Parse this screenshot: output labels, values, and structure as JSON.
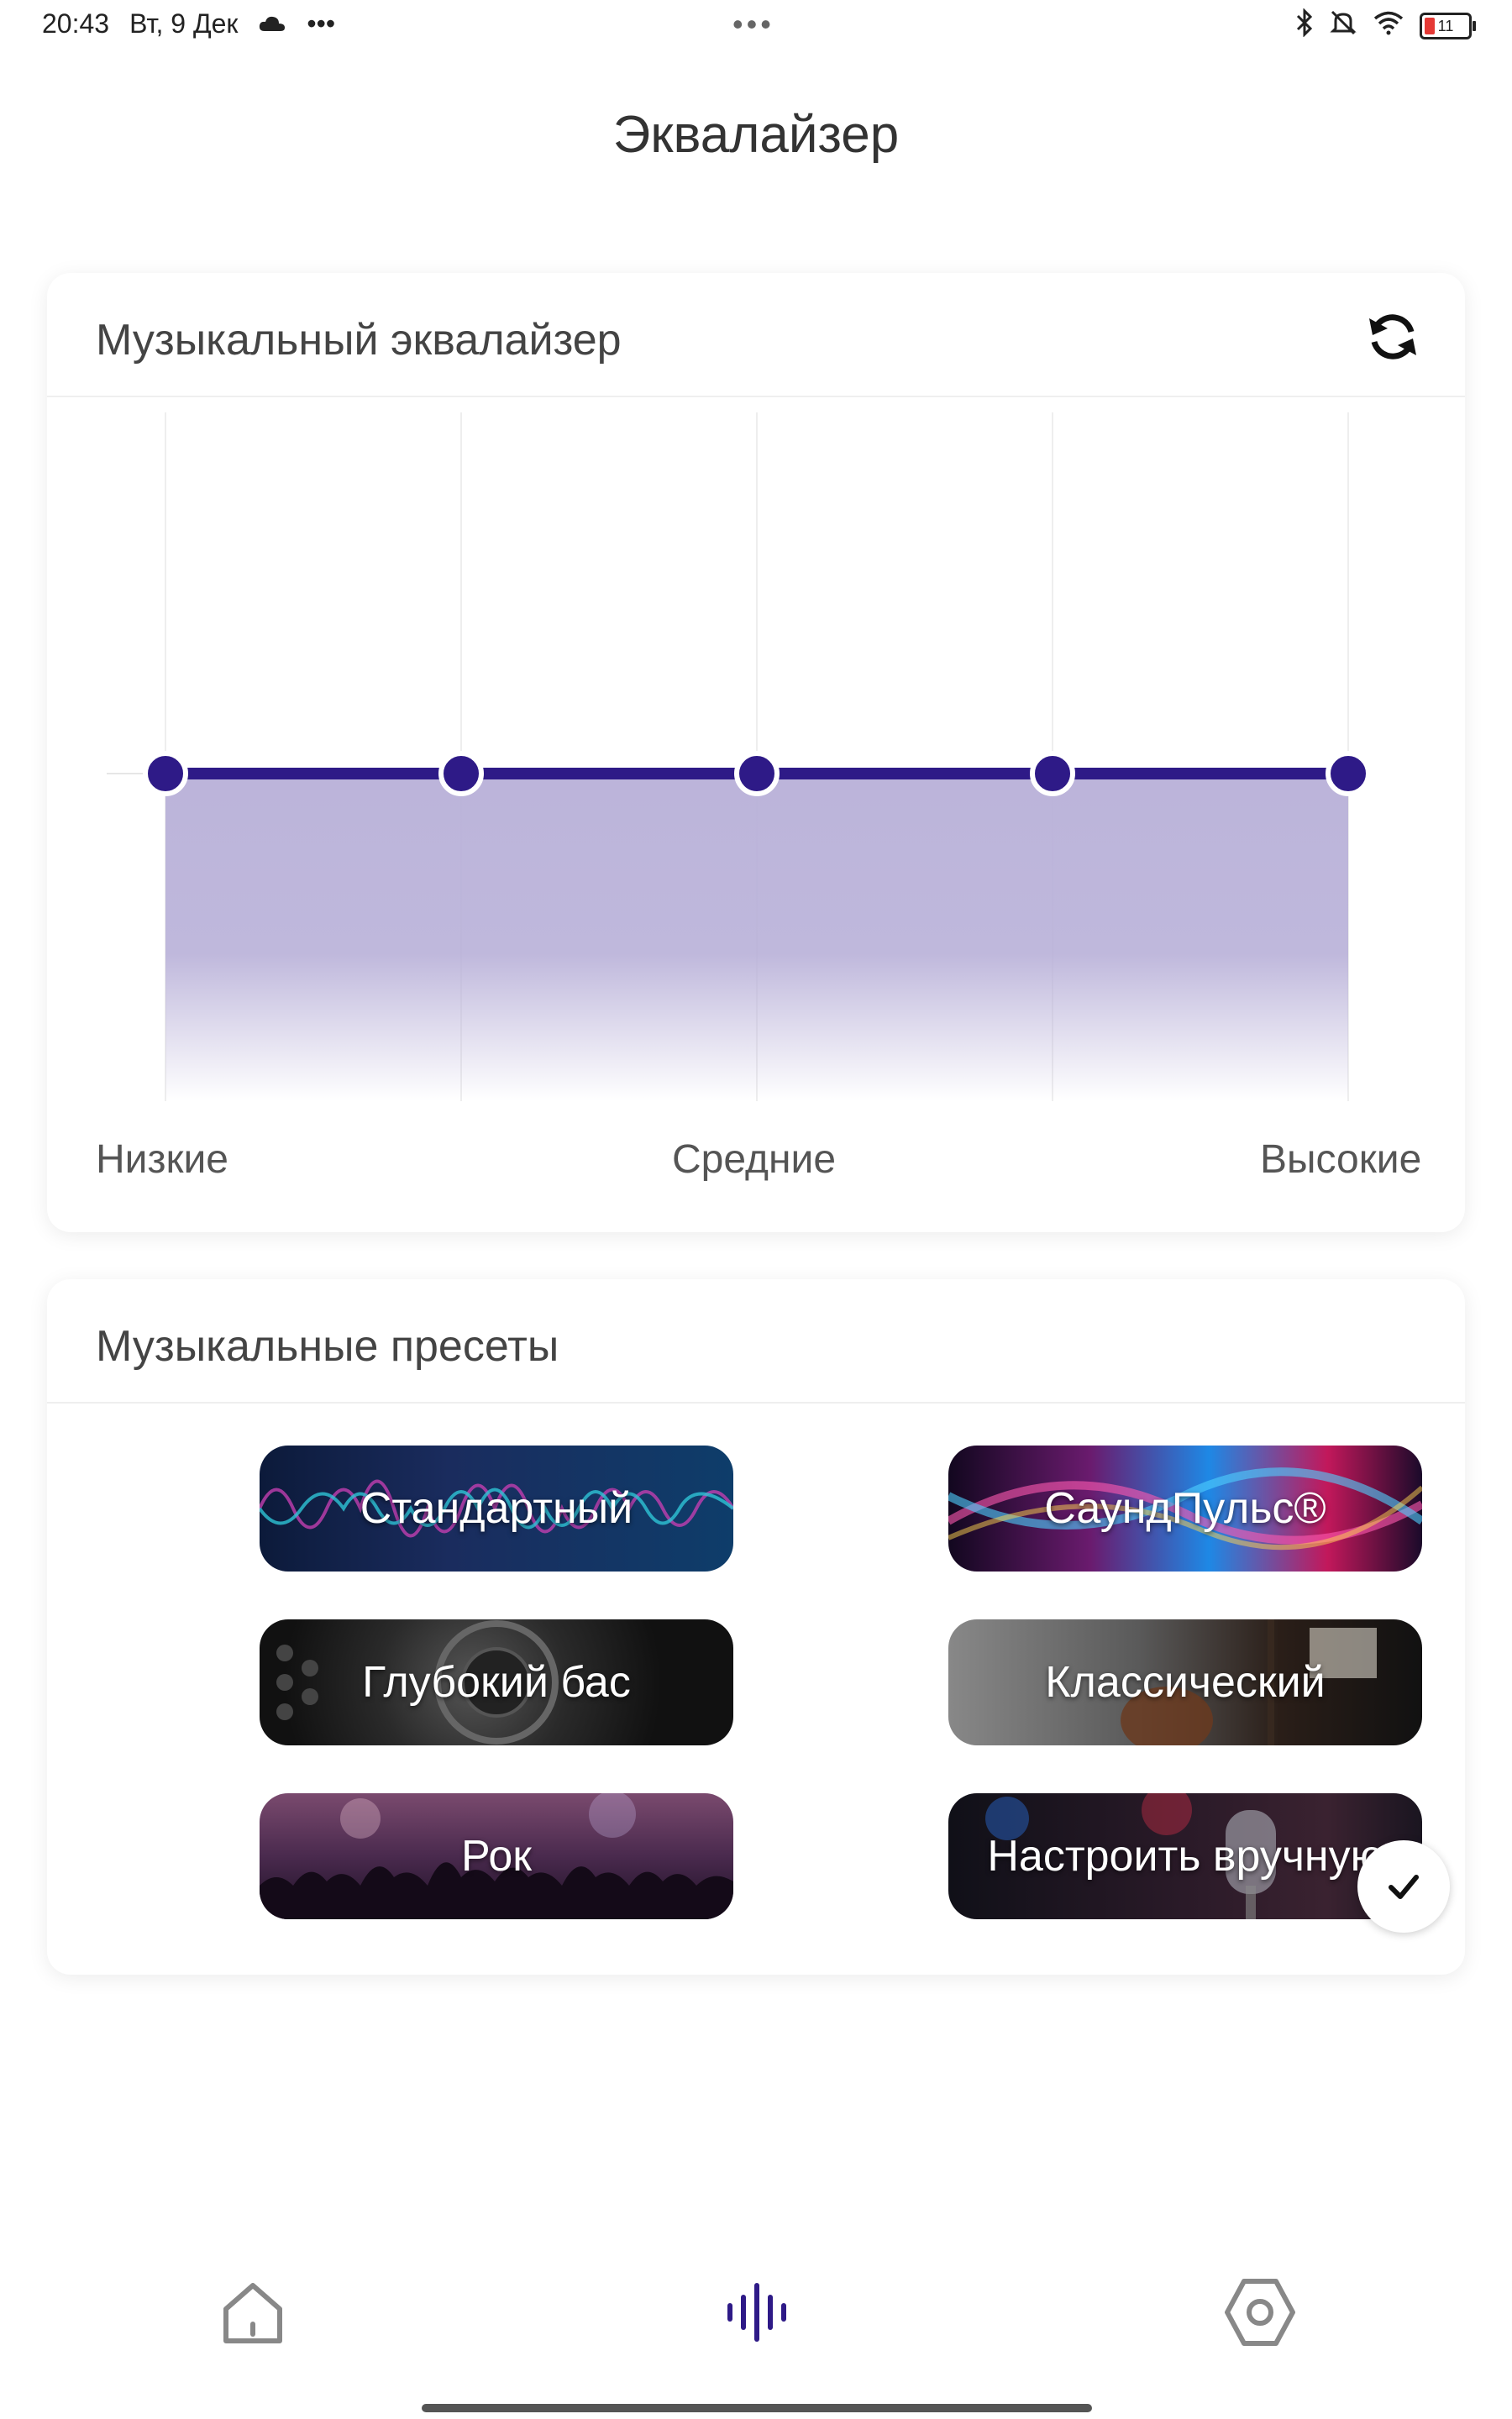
{
  "status_bar": {
    "time": "20:43",
    "date": "Вт, 9 Дек",
    "weather_icon": "cloud-icon",
    "more": "•••",
    "center_dots": "•••",
    "battery": "11"
  },
  "page_title": "Эквалайзер",
  "equalizer": {
    "title": "Музыкальный эквалайзер",
    "reset_icon": "refresh-icon",
    "labels": {
      "low": "Низкие",
      "mid": "Средние",
      "high": "Высокие"
    },
    "accent_color": "#2e1a87",
    "fill_color": "#b8b0d8",
    "bands": [
      0.5,
      0.5,
      0.5,
      0.5,
      0.5
    ]
  },
  "presets": {
    "title": "Музыкальные пресеты",
    "items": [
      {
        "label": "Стандартный"
      },
      {
        "label": "СаундПульс®"
      },
      {
        "label": "Глубокий бас"
      },
      {
        "label": "Классический"
      },
      {
        "label": "Рок"
      },
      {
        "label": "Настроить вручную",
        "selected": true
      }
    ]
  },
  "bottom_nav": {
    "items": [
      "home-icon",
      "equalizer-icon",
      "settings-icon"
    ],
    "active": "equalizer-icon",
    "active_color": "#2e1a87",
    "inactive_color": "#888888"
  }
}
